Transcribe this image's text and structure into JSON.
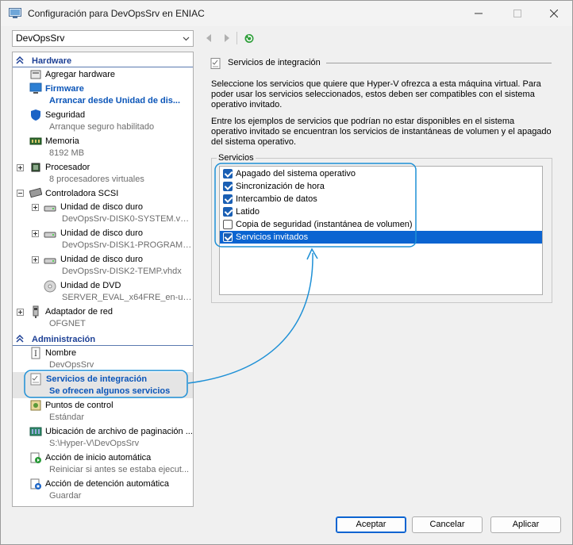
{
  "window": {
    "title": "Configuración para DevOpsSrv en ENIAC",
    "minimize_icon": "minimize-icon",
    "maximize_icon": "maximize-icon",
    "close_icon": "close-icon"
  },
  "toolbar": {
    "vm_selected": "DevOpsSrv",
    "back_icon": "back-arrow-icon",
    "forward_icon": "forward-arrow-icon",
    "refresh_icon": "refresh-icon"
  },
  "sidebar": {
    "hardware_header": "Hardware",
    "admin_header": "Administración",
    "items": [
      {
        "title": "Agregar hardware",
        "subtitle": ""
      },
      {
        "title": "Firmware",
        "subtitle": "Arrancar desde Unidad de dis..."
      },
      {
        "title": "Seguridad",
        "subtitle": "Arranque seguro habilitado"
      },
      {
        "title": "Memoria",
        "subtitle": "8192 MB"
      },
      {
        "title": "Procesador",
        "subtitle": "8 procesadores virtuales"
      },
      {
        "title": "Controladora SCSI",
        "subtitle": ""
      },
      {
        "title": "Unidad de disco duro",
        "subtitle": "DevOpsSrv-DISK0-SYSTEM.vhdx"
      },
      {
        "title": "Unidad de disco duro",
        "subtitle": "DevOpsSrv-DISK1-PROGRAMS...."
      },
      {
        "title": "Unidad de disco duro",
        "subtitle": "DevOpsSrv-DISK2-TEMP.vhdx"
      },
      {
        "title": "Unidad de DVD",
        "subtitle": "SERVER_EVAL_x64FRE_en-us...."
      },
      {
        "title": "Adaptador de red",
        "subtitle": "OFGNET"
      },
      {
        "title": "Nombre",
        "subtitle": "DevOpsSrv"
      },
      {
        "title": "Servicios de integración",
        "subtitle": "Se ofrecen algunos servicios"
      },
      {
        "title": "Puntos de control",
        "subtitle": "Estándar"
      },
      {
        "title": "Ubicación de archivo de paginación ...",
        "subtitle": "S:\\Hyper-V\\DevOpsSrv"
      },
      {
        "title": "Acción de inicio automática",
        "subtitle": "Reiniciar si antes se estaba ejecut..."
      },
      {
        "title": "Acción de detención automática",
        "subtitle": "Guardar"
      }
    ]
  },
  "panel": {
    "title": "Servicios de integración",
    "desc1": "Seleccione los servicios que quiere que Hyper-V ofrezca a esta máquina virtual. Para poder usar los servicios seleccionados, estos deben ser compatibles con el sistema operativo invitado.",
    "desc2": "Entre los ejemplos de servicios que podrían no estar disponibles en el sistema operativo invitado se encuentran los servicios de instantáneas de volumen y el apagado del sistema operativo.",
    "group_label": "Servicios",
    "services": [
      {
        "label": "Apagado del sistema operativo",
        "checked": true
      },
      {
        "label": "Sincronización de hora",
        "checked": true
      },
      {
        "label": "Intercambio de datos",
        "checked": true
      },
      {
        "label": "Latido",
        "checked": true
      },
      {
        "label": "Copia de seguridad (instantánea de volumen)",
        "checked": false
      },
      {
        "label": "Servicios invitados",
        "checked": true
      }
    ]
  },
  "buttons": {
    "accept": "Aceptar",
    "cancel": "Cancelar",
    "apply": "Aplicar"
  },
  "colors": {
    "accent": "#0b64d1",
    "callout": "#1e90d6",
    "section_header": "#1c3f95"
  }
}
